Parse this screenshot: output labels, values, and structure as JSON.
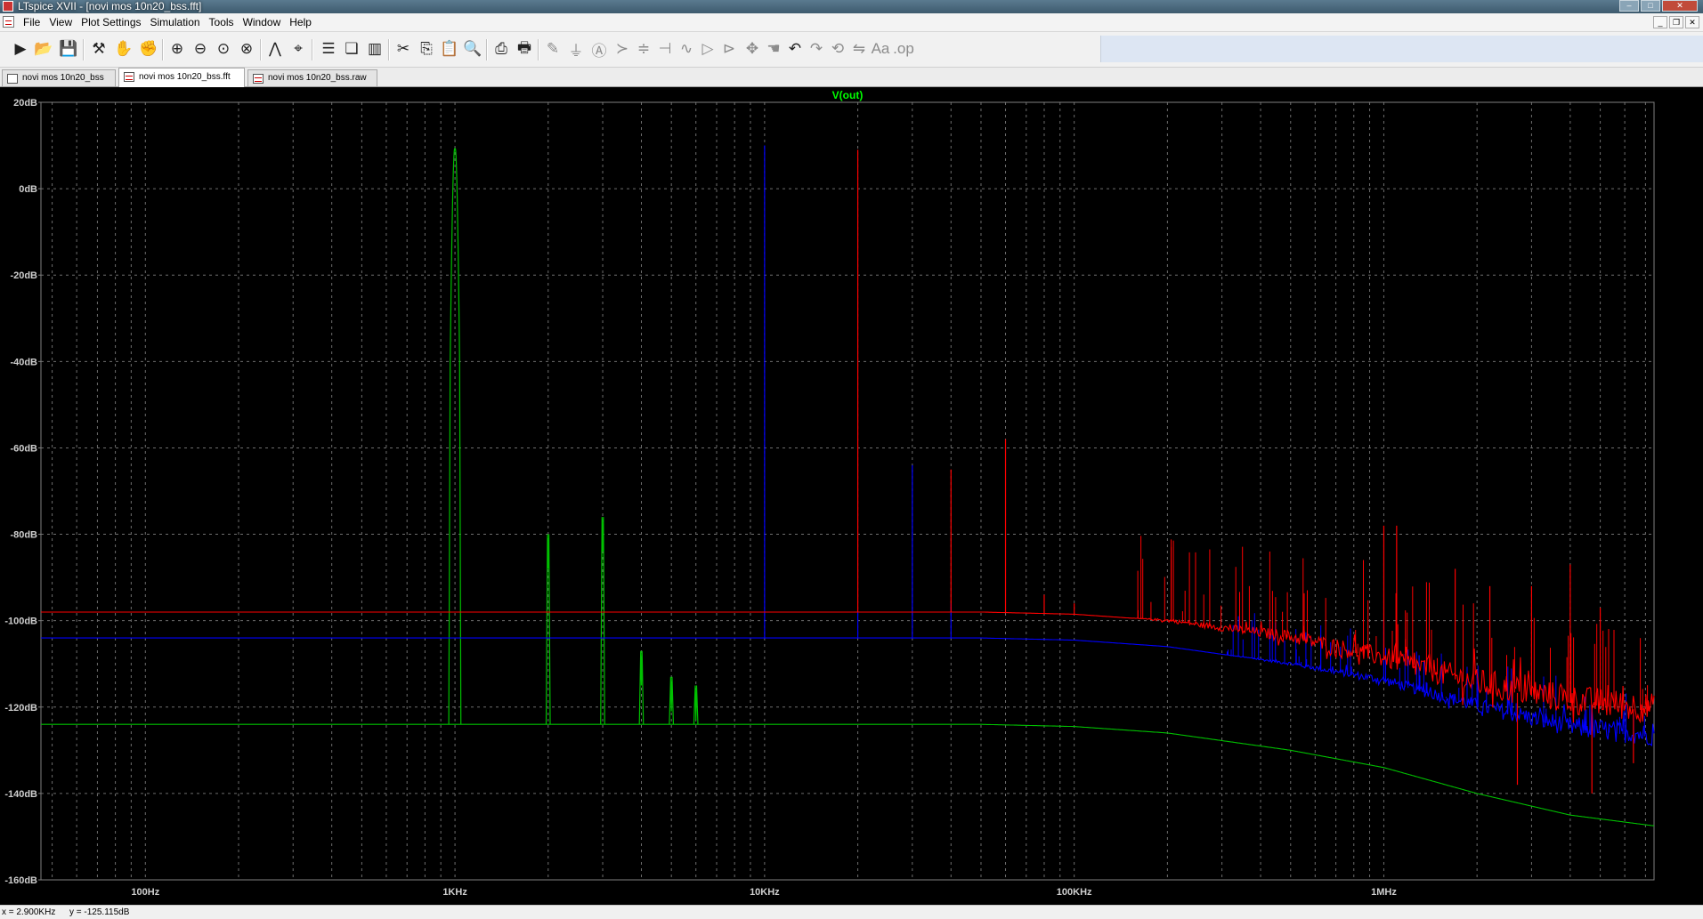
{
  "window": {
    "title": "LTspice XVII - [novi mos 10n20_bss.fft]"
  },
  "menu": {
    "items": [
      "File",
      "View",
      "Plot Settings",
      "Simulation",
      "Tools",
      "Window",
      "Help"
    ]
  },
  "toolbar": {
    "icons": [
      "run-icon",
      "open-icon",
      "save-icon",
      "control-panel-icon",
      "halt-icon",
      "pan-icon",
      "zoom-in-icon",
      "zoom-out-icon",
      "zoom-fit-icon",
      "zoom-cancel-icon",
      "autorange-icon",
      "markers-icon",
      "tile-horizontal-icon",
      "cascade-icon",
      "tile-vertical-icon",
      "cut-icon",
      "copy-icon",
      "paste-icon",
      "find-icon",
      "print-preview-icon",
      "print-icon",
      "wire-icon",
      "ground-icon",
      "label-net-icon",
      "component-icon",
      "resistor-icon",
      "capacitor-icon",
      "inductor-icon",
      "diode-icon",
      "component-symbol-icon",
      "move-icon",
      "drag-icon",
      "undo-icon",
      "redo-icon",
      "rotate-icon",
      "mirror-icon",
      "text-icon",
      "spice-directive-icon"
    ]
  },
  "tabs": [
    {
      "label": "novi mos 10n20_bss",
      "icon": "schematic-icon",
      "active": false
    },
    {
      "label": "novi mos 10n20_bss.fft",
      "icon": "waveform-icon",
      "active": true
    },
    {
      "label": "novi mos 10n20_bss.raw",
      "icon": "waveform-icon",
      "active": false
    }
  ],
  "status": {
    "x": "x = 2.900KHz",
    "y": "y = -125.115dB"
  },
  "chart_data": {
    "type": "line",
    "title": "V(out)",
    "title_color": "#00ff00",
    "x_scale": "log",
    "xlim": [
      46,
      7460000
    ],
    "ylim": [
      -160,
      20
    ],
    "x_ticks": [
      {
        "value": 100,
        "label": "100Hz"
      },
      {
        "value": 1000,
        "label": "1KHz"
      },
      {
        "value": 10000,
        "label": "10KHz"
      },
      {
        "value": 100000,
        "label": "100KHz"
      },
      {
        "value": 1000000,
        "label": "1MHz"
      }
    ],
    "y_ticks": [
      {
        "value": 20,
        "label": "20dB"
      },
      {
        "value": 0,
        "label": "0dB"
      },
      {
        "value": -20,
        "label": "-20dB"
      },
      {
        "value": -40,
        "label": "-40dB"
      },
      {
        "value": -60,
        "label": "-60dB"
      },
      {
        "value": -80,
        "label": "-80dB"
      },
      {
        "value": -100,
        "label": "-100dB"
      },
      {
        "value": -120,
        "label": "-120dB"
      },
      {
        "value": -140,
        "label": "-140dB"
      },
      {
        "value": -160,
        "label": "-160dB"
      }
    ],
    "grid": true,
    "background": "#000000",
    "series": [
      {
        "color": "#00c000",
        "floor": [
          [
            46,
            -124
          ],
          [
            1000,
            -124
          ],
          [
            10000,
            -124
          ],
          [
            50000,
            -124
          ],
          [
            100000,
            -124.5
          ],
          [
            200000,
            -126
          ],
          [
            500000,
            -130
          ],
          [
            1000000,
            -134
          ],
          [
            2000000,
            -140
          ],
          [
            4000000,
            -145
          ],
          [
            7460000,
            -147.5
          ]
        ],
        "peaks": [
          [
            1000,
            9
          ],
          [
            2000,
            -88
          ],
          [
            3000,
            -84
          ],
          [
            4000,
            -115
          ],
          [
            5000,
            -121
          ],
          [
            6000,
            -123
          ]
        ]
      },
      {
        "color": "#0000ff",
        "floor": [
          [
            46,
            -104
          ],
          [
            10000,
            -104
          ],
          [
            50000,
            -104
          ],
          [
            100000,
            -104.5
          ],
          [
            200000,
            -106
          ],
          [
            500000,
            -110
          ],
          [
            1000000,
            -114
          ],
          [
            2000000,
            -120
          ],
          [
            4000000,
            -125
          ],
          [
            7460000,
            -127
          ]
        ],
        "peaks": [
          [
            10000,
            10
          ],
          [
            20000,
            -98
          ],
          [
            30000,
            -64
          ],
          [
            40000,
            -96
          ],
          [
            1000000,
            -100
          ],
          [
            1300000,
            -108
          ],
          [
            2000000,
            -112
          ],
          [
            3000,
            -104
          ]
        ],
        "noise_from": 300000,
        "noise_amp": 5
      },
      {
        "color": "#ff0000",
        "floor": [
          [
            46,
            -98
          ],
          [
            10000,
            -98
          ],
          [
            50000,
            -98
          ],
          [
            100000,
            -98.5
          ],
          [
            200000,
            -100
          ],
          [
            500000,
            -104
          ],
          [
            1000000,
            -109
          ],
          [
            2000000,
            -115
          ],
          [
            4000000,
            -119
          ],
          [
            7460000,
            -121
          ]
        ],
        "peaks": [
          [
            20000,
            9
          ],
          [
            40000,
            -65
          ],
          [
            60000,
            -58
          ],
          [
            80000,
            -94
          ],
          [
            100000,
            -96
          ],
          [
            1000000,
            -78
          ],
          [
            1100000,
            -78
          ],
          [
            1700000,
            -88
          ],
          [
            2200000,
            -92
          ],
          [
            3000000,
            -92
          ],
          [
            4000000,
            -87
          ],
          [
            5000000,
            -97
          ]
        ],
        "dips": [
          [
            2700000,
            -138
          ],
          [
            4700000,
            -140
          ],
          [
            6400000,
            -133
          ]
        ],
        "noise_from": 150000,
        "noise_amp": 7
      }
    ]
  }
}
